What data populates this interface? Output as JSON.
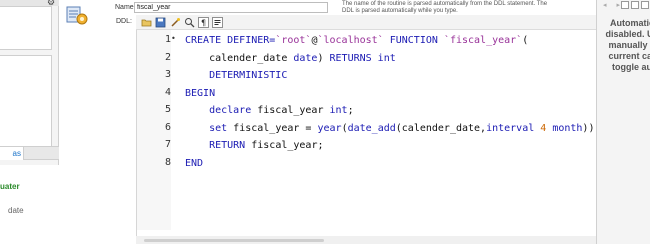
{
  "left": {
    "tab_label": "as",
    "detail_title": "uater",
    "detail_sub": "date"
  },
  "routine": {
    "name_label": "Name:",
    "name_value": "fiscal_year",
    "ddl_label": "DDL:",
    "info_text": "The name of the routine is parsed automatically from the DDL statement. The DDL is parsed automatically while you type."
  },
  "toolbar": {
    "icons": [
      "folder-open-icon",
      "save-icon",
      "beautify-icon",
      "find-icon",
      "invisible-chars-icon",
      "word-wrap-icon"
    ]
  },
  "editor": {
    "line_numbers": [
      "1",
      "2",
      "3",
      "4",
      "5",
      "6",
      "7",
      "8"
    ],
    "lines": [
      [
        {
          "t": "CREATE DEFINER=",
          "c": "kw"
        },
        {
          "t": "`root`",
          "c": "str"
        },
        {
          "t": "@",
          "c": "plain"
        },
        {
          "t": "`localhost`",
          "c": "str"
        },
        {
          "t": " FUNCTION ",
          "c": "kw"
        },
        {
          "t": "`fiscal_year`",
          "c": "str"
        },
        {
          "t": "(",
          "c": "plain"
        }
      ],
      [
        {
          "t": "    calender_date ",
          "c": "id"
        },
        {
          "t": "date",
          "c": "kw"
        },
        {
          "t": ") ",
          "c": "plain"
        },
        {
          "t": "RETURNS int",
          "c": "kw"
        }
      ],
      [
        {
          "t": "    DETERMINISTIC",
          "c": "kw"
        }
      ],
      [
        {
          "t": "BEGIN",
          "c": "kw"
        }
      ],
      [
        {
          "t": "    declare ",
          "c": "kw"
        },
        {
          "t": "fiscal_year ",
          "c": "id"
        },
        {
          "t": "int",
          "c": "kw"
        },
        {
          "t": ";",
          "c": "plain"
        }
      ],
      [
        {
          "t": "    set ",
          "c": "kw"
        },
        {
          "t": "fiscal_year = ",
          "c": "id"
        },
        {
          "t": "year",
          "c": "fn"
        },
        {
          "t": "(",
          "c": "plain"
        },
        {
          "t": "date_add",
          "c": "fn"
        },
        {
          "t": "(calender_date,",
          "c": "id"
        },
        {
          "t": "interval ",
          "c": "kw"
        },
        {
          "t": "4 ",
          "c": "num"
        },
        {
          "t": "month",
          "c": "kw"
        },
        {
          "t": "));",
          "c": "plain"
        }
      ],
      [
        {
          "t": "    RETURN ",
          "c": "kw"
        },
        {
          "t": "fiscal_year;",
          "c": "id"
        }
      ],
      [
        {
          "t": "END",
          "c": "kw"
        }
      ]
    ]
  },
  "right": {
    "nav_arrows": "◂ ▸",
    "help_text": "Automatic disabled. Us manually g current car toggle au"
  },
  "colors": {
    "keyword": "#1b1bb3",
    "string": "#993399",
    "number": "#cc6600",
    "accent_green": "#2a8a2a"
  }
}
